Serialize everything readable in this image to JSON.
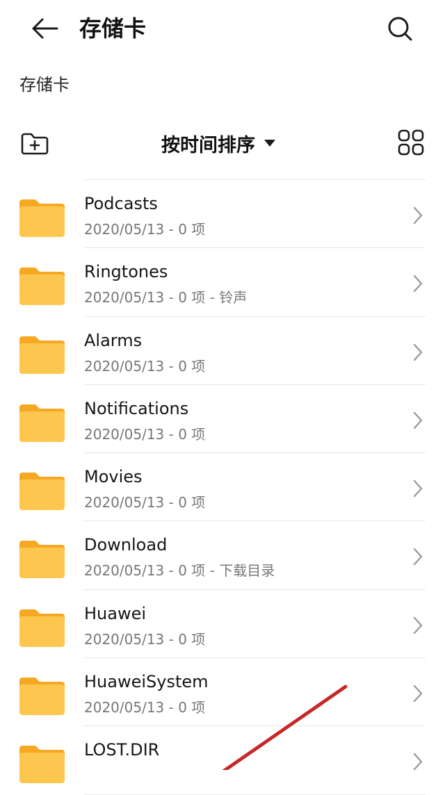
{
  "header": {
    "title": "存储卡"
  },
  "breadcrumb": {
    "label": "存储卡"
  },
  "toolbar": {
    "sort_label": "按时间排序"
  },
  "icons": {
    "back": "arrow-left-icon",
    "search": "search-icon",
    "new_folder": "new-folder-icon",
    "sort": "caret-down-icon",
    "view": "grid-view-icon",
    "folder": "folder-icon",
    "chevron": "chevron-right-icon"
  },
  "colors": {
    "folder_body": "#FDC74F",
    "folder_tab": "#F7A823",
    "annotation_line": "#C62828"
  },
  "files": [
    {
      "name": "Podcasts",
      "meta": "2020/05/13 - 0 项"
    },
    {
      "name": "Ringtones",
      "meta": "2020/05/13 - 0 项 - 铃声"
    },
    {
      "name": "Alarms",
      "meta": "2020/05/13 - 0 项"
    },
    {
      "name": "Notifications",
      "meta": "2020/05/13 - 0 项"
    },
    {
      "name": "Movies",
      "meta": "2020/05/13 - 0 项"
    },
    {
      "name": "Download",
      "meta": "2020/05/13 - 0 项 - 下载目录"
    },
    {
      "name": "Huawei",
      "meta": "2020/05/13 - 0 项"
    },
    {
      "name": "HuaweiSystem",
      "meta": "2020/05/13 - 0 项"
    },
    {
      "name": "LOST.DIR",
      "meta": ""
    }
  ]
}
